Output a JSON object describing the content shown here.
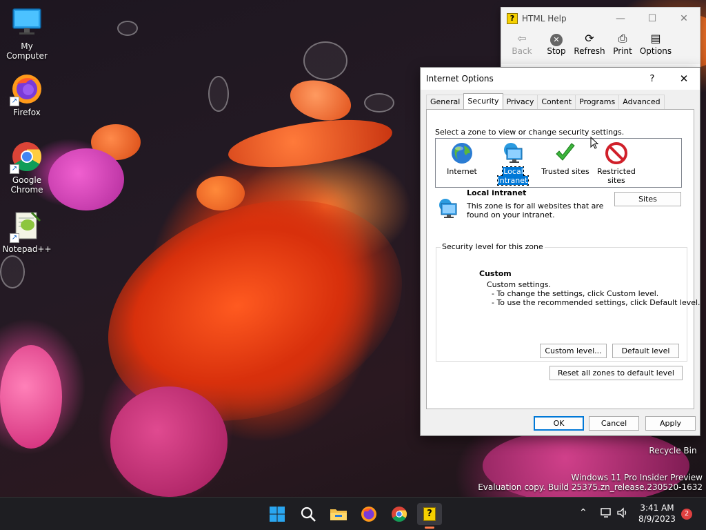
{
  "desktop": {
    "icons": [
      {
        "label": "My Computer"
      },
      {
        "label": "Firefox"
      },
      {
        "label": "Google Chrome"
      },
      {
        "label": "Notepad++"
      }
    ],
    "recycle_bin": "Recycle Bin",
    "watermark_line1": "Windows 11 Pro Insider Preview",
    "watermark_line2": "Evaluation copy. Build 25375.zn_release.230520-1632"
  },
  "help_window": {
    "title": "HTML Help",
    "toolbar": {
      "back": "Back",
      "stop": "Stop",
      "refresh": "Refresh",
      "print": "Print",
      "options": "Options"
    }
  },
  "dialog": {
    "title": "Internet Options",
    "help_glyph": "?",
    "close_glyph": "✕",
    "tabs": [
      "General",
      "Security",
      "Privacy",
      "Content",
      "Programs",
      "Advanced"
    ],
    "active_tab": "Security",
    "zone_prompt": "Select a zone to view or change security settings.",
    "zones": [
      {
        "label": "Internet",
        "icon": "globe-icon"
      },
      {
        "label": "Local intranet",
        "icon": "intranet-icon"
      },
      {
        "label": "Trusted sites",
        "icon": "checkmark-icon"
      },
      {
        "label": "Restricted sites",
        "icon": "restricted-icon"
      }
    ],
    "selected_zone": "Local intranet",
    "zone_title": "Local intranet",
    "zone_description": "This zone is for all websites that are found on your intranet.",
    "sites_button": "Sites",
    "security_level_legend": "Security level for this zone",
    "level_name": "Custom",
    "level_lines": "Custom settings.\n  - To change the settings, click Custom level.\n  - To use the recommended settings, click Default level.",
    "custom_level_button": "Custom level...",
    "default_level_button": "Default level",
    "reset_button": "Reset all zones to default level",
    "ok_button": "OK",
    "cancel_button": "Cancel",
    "apply_button": "Apply"
  },
  "taskbar": {
    "clock_time": "3:41 AM",
    "clock_date": "8/9/2023",
    "notification_count": "2",
    "accent": "#0078d7"
  }
}
